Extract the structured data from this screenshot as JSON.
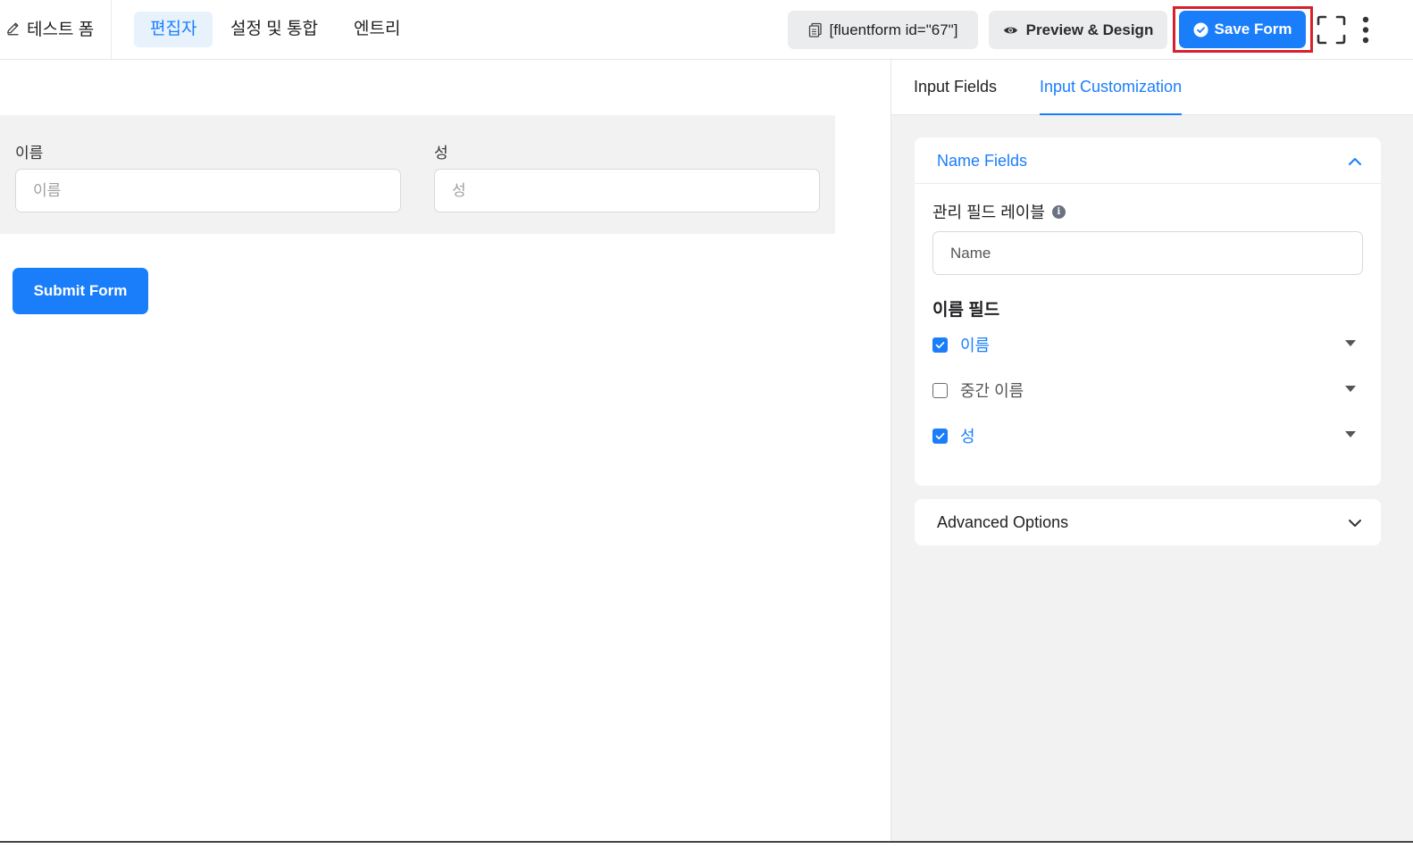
{
  "header": {
    "form_title": "테스트 폼",
    "tabs": [
      {
        "label": "편집자",
        "active": true
      },
      {
        "label": "설정 및 통합",
        "active": false
      },
      {
        "label": "엔트리",
        "active": false
      }
    ],
    "shortcode": "[fluentform id=\"67\"]",
    "preview_label": "Preview & Design",
    "save_label": "Save Form"
  },
  "canvas": {
    "first_name_label": "이름",
    "first_name_placeholder": "이름",
    "last_name_label": "성",
    "last_name_placeholder": "성",
    "submit_label": "Submit Form"
  },
  "panel": {
    "tabs": [
      {
        "label": "Input Fields",
        "active": false
      },
      {
        "label": "Input Customization",
        "active": true
      }
    ],
    "name_fields": {
      "title": "Name Fields",
      "expanded": true,
      "admin_label": "관리 필드 레이블",
      "admin_value": "Name",
      "section_heading": "이름 필드",
      "options": [
        {
          "label": "이름",
          "checked": true
        },
        {
          "label": "중간 이름",
          "checked": false
        },
        {
          "label": "성",
          "checked": true
        }
      ]
    },
    "advanced": {
      "title": "Advanced Options",
      "expanded": false
    }
  },
  "colors": {
    "accent": "#1a7efb",
    "highlight": "#d8202c",
    "panel_bg": "#f2f2f2"
  }
}
